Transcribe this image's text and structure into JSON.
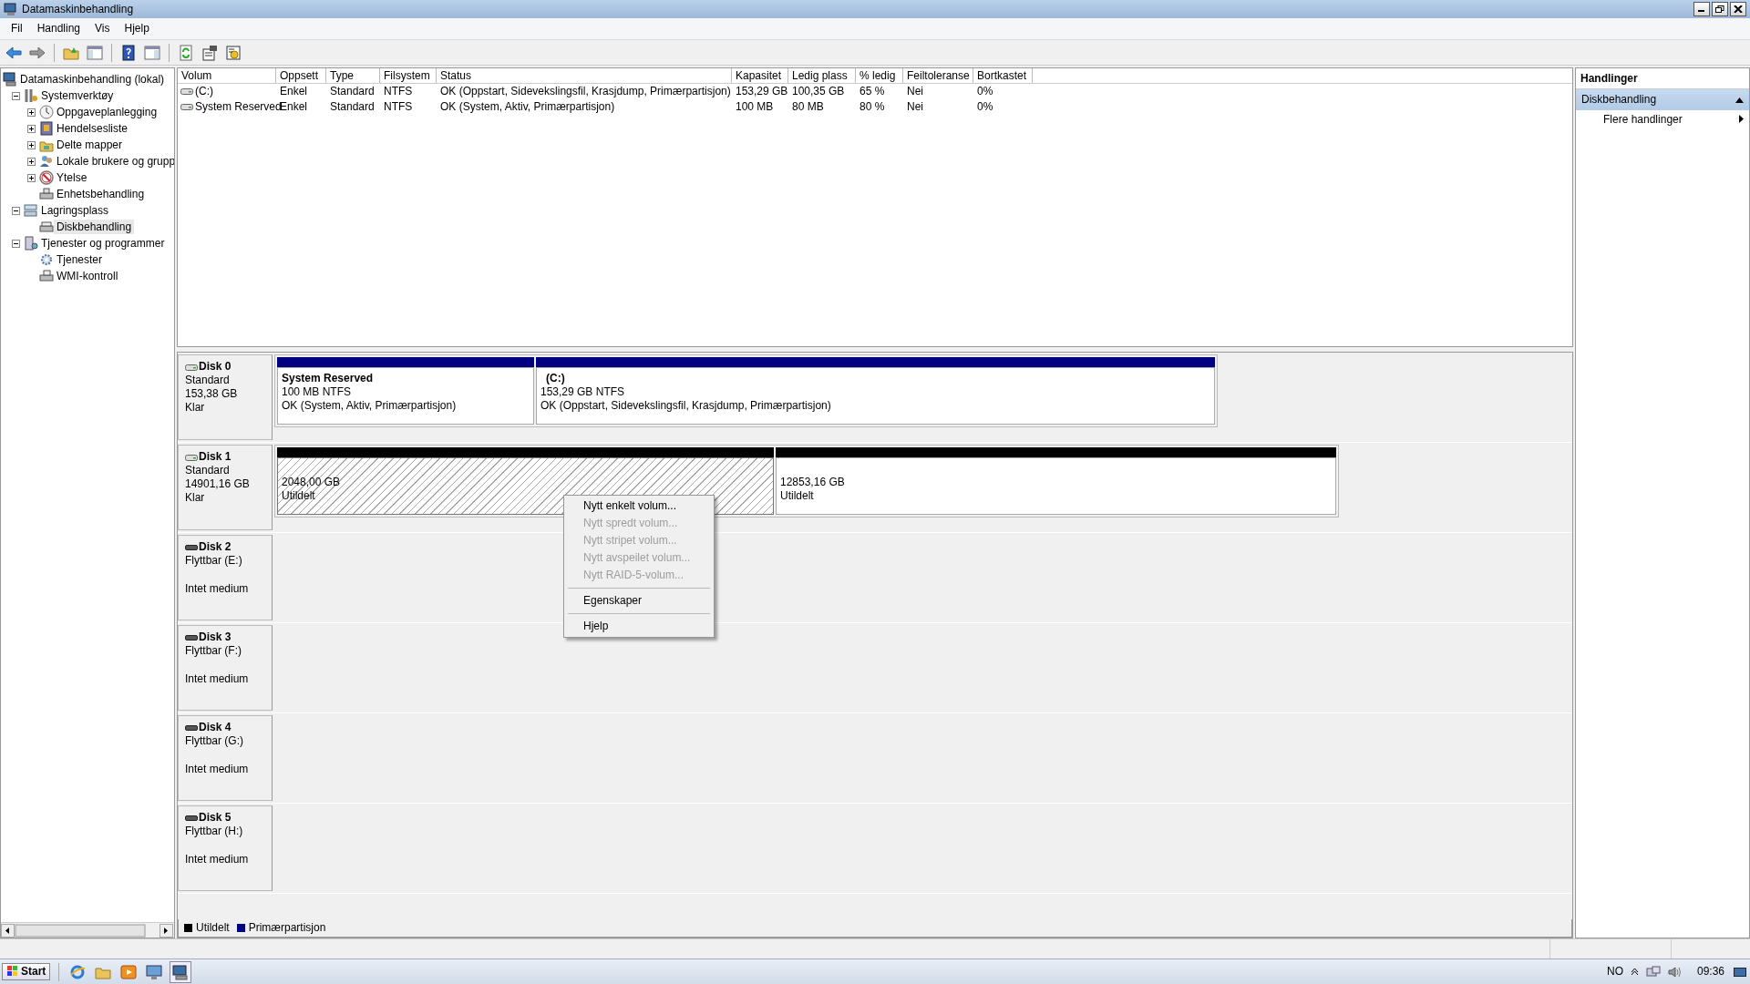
{
  "window": {
    "title": "Datamaskinbehandling"
  },
  "menu": [
    "Fil",
    "Handling",
    "Vis",
    "Hjelp"
  ],
  "tree": [
    {
      "label": "Datamaskinbehandling (lokal)",
      "selected": false,
      "children": [
        {
          "label": "Systemverktøy",
          "expanded": true,
          "selected": false,
          "children": [
            {
              "label": "Oppgaveplanlegging",
              "expanded": false,
              "selected": false
            },
            {
              "label": "Hendelsesliste",
              "expanded": false,
              "selected": false
            },
            {
              "label": "Delte mapper",
              "expanded": false,
              "selected": false
            },
            {
              "label": "Lokale brukere og grupp",
              "expanded": false,
              "selected": false
            },
            {
              "label": "Ytelse",
              "expanded": false,
              "selected": false
            },
            {
              "label": "Enhetsbehandling",
              "selected": false
            }
          ]
        },
        {
          "label": "Lagringsplass",
          "expanded": true,
          "selected": false,
          "children": [
            {
              "label": "Diskbehandling",
              "selected": true
            }
          ]
        },
        {
          "label": "Tjenester og programmer",
          "expanded": true,
          "selected": false,
          "children": [
            {
              "label": "Tjenester",
              "selected": false
            },
            {
              "label": "WMI-kontroll",
              "selected": false
            }
          ]
        }
      ]
    }
  ],
  "table": {
    "columns": [
      "Volum",
      "Oppsett",
      "Type",
      "Filsystem",
      "Status",
      "Kapasitet",
      "Ledig plass",
      "% ledig",
      "Feiltoleranse",
      "Bortkastet"
    ],
    "rows": [
      [
        "(C:)",
        "Enkel",
        "Standard",
        "NTFS",
        "OK (Oppstart, Sidevekslingsfil, Krasjdump, Primærpartisjon)",
        "153,29 GB",
        "100,35 GB",
        "65 %",
        "Nei",
        "0%"
      ],
      [
        "System Reserved",
        "Enkel",
        "Standard",
        "NTFS",
        "OK (System, Aktiv, Primærpartisjon)",
        "100 MB",
        "80 MB",
        "80 %",
        "Nei",
        "0%"
      ]
    ]
  },
  "disks": [
    {
      "kind": "fixed",
      "name": "Disk 0",
      "type": "Standard",
      "size": "153,38 GB",
      "status": "Klar",
      "partitions": [
        {
          "kind": "primary",
          "selected": false,
          "title": "System Reserved",
          "size": "100 MB NTFS",
          "status": "OK (System, Aktiv, Primærpartisjon)"
        },
        {
          "kind": "primary",
          "selected": false,
          "title": "(C:)",
          "size": "153,29 GB NTFS",
          "status": "OK (Oppstart, Sidevekslingsfil, Krasjdump, Primærpartisjon)"
        }
      ]
    },
    {
      "kind": "fixed",
      "name": "Disk 1",
      "type": "Standard",
      "size": "14901,16 GB",
      "status": "Klar",
      "partitions": [
        {
          "kind": "unallocated",
          "selected": true,
          "size": "2048,00 GB",
          "status": "Utildelt"
        },
        {
          "kind": "unallocated",
          "selected": false,
          "size": "12853,16 GB",
          "status": "Utildelt"
        }
      ]
    },
    {
      "kind": "removable",
      "name": "Disk 2",
      "type": "Flyttbar (E:)",
      "status": "Intet medium"
    },
    {
      "kind": "removable",
      "name": "Disk 3",
      "type": "Flyttbar (F:)",
      "status": "Intet medium"
    },
    {
      "kind": "removable",
      "name": "Disk 4",
      "type": "Flyttbar (G:)",
      "status": "Intet medium"
    },
    {
      "kind": "removable",
      "name": "Disk 5",
      "type": "Flyttbar (H:)",
      "status": "Intet medium"
    }
  ],
  "legend": [
    {
      "label": "Utildelt",
      "color": "#000000"
    },
    {
      "label": "Primærpartisjon",
      "color": "#000080"
    }
  ],
  "actions": {
    "title": "Handlinger",
    "section": "Diskbehandling",
    "expanded": true,
    "items": [
      "Flere handlinger"
    ]
  },
  "context_menu": [
    {
      "kind": "item",
      "label": "Nytt enkelt volum...",
      "disabled": false
    },
    {
      "kind": "item",
      "label": "Nytt spredt volum...",
      "disabled": true
    },
    {
      "kind": "item",
      "label": "Nytt stripet volum...",
      "disabled": true
    },
    {
      "kind": "item",
      "label": "Nytt avspeilet volum...",
      "disabled": true
    },
    {
      "kind": "item",
      "label": "Nytt RAID-5-volum...",
      "disabled": true
    },
    {
      "kind": "separator"
    },
    {
      "kind": "item",
      "label": "Egenskaper",
      "disabled": false
    },
    {
      "kind": "separator"
    },
    {
      "kind": "item",
      "label": "Hjelp",
      "disabled": false
    }
  ],
  "taskbar": {
    "start": "Start",
    "language": "NO",
    "time": "09:36"
  }
}
